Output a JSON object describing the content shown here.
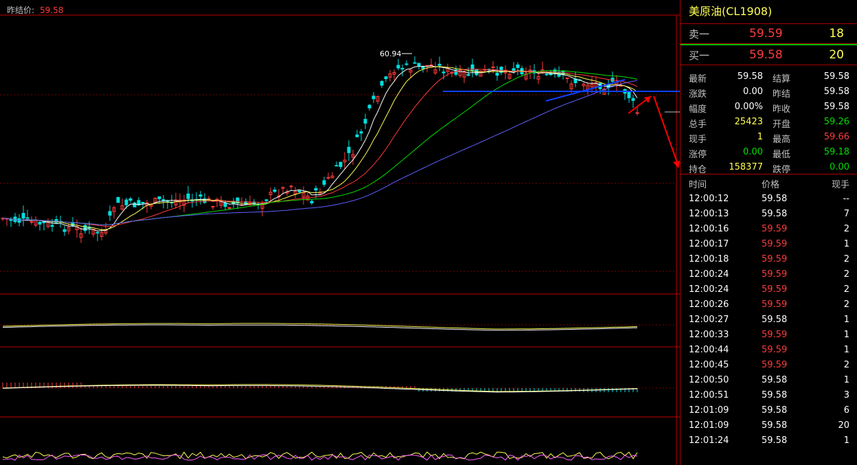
{
  "chart": {
    "prev_settle_label": "昨结价:",
    "prev_settle_value": "59.58",
    "high_marker": "60.94",
    "colors": {
      "up": "#ff3b3b",
      "down": "#00e0e0",
      "ma5": "#ffffff",
      "ma10": "#ffff54",
      "ma20": "#ff3b3b",
      "ma40": "#00e000",
      "ma60": "#6060ff",
      "trendline": "#1040ff",
      "arrow": "#ff0000"
    }
  },
  "panel": {
    "title": "美原油(CL1908)",
    "ask": {
      "label": "卖一",
      "price": "59.59",
      "vol": "18"
    },
    "bid": {
      "label": "买一",
      "price": "59.58",
      "vol": "20"
    },
    "stats": [
      {
        "l1": "最新",
        "v1": "59.58",
        "c1": "w",
        "l2": "结算",
        "v2": "59.58",
        "c2": "w"
      },
      {
        "l1": "涨跌",
        "v1": "0.00",
        "c1": "w",
        "l2": "昨结",
        "v2": "59.58",
        "c2": "w"
      },
      {
        "l1": "幅度",
        "v1": "0.00%",
        "c1": "w",
        "l2": "昨收",
        "v2": "59.58",
        "c2": "w"
      },
      {
        "l1": "总手",
        "v1": "25423",
        "c1": "y",
        "l2": "开盘",
        "v2": "59.26",
        "c2": "g"
      },
      {
        "l1": "现手",
        "v1": "1",
        "c1": "y",
        "l2": "最高",
        "v2": "59.66",
        "c2": "r"
      },
      {
        "l1": "涨停",
        "v1": "0.00",
        "c1": "g",
        "l2": "最低",
        "v2": "59.18",
        "c2": "g"
      },
      {
        "l1": "持仓",
        "v1": "158377",
        "c1": "y",
        "l2": "跌停",
        "v2": "0.00",
        "c2": "g"
      }
    ],
    "ticks_header": {
      "time": "时间",
      "price": "价格",
      "vol": "现手"
    },
    "ticks": [
      {
        "time": "12:00:12",
        "price": "59.58",
        "color": "w",
        "vol": "--"
      },
      {
        "time": "12:00:13",
        "price": "59.58",
        "color": "w",
        "vol": "7"
      },
      {
        "time": "12:00:16",
        "price": "59.59",
        "color": "r",
        "vol": "2"
      },
      {
        "time": "12:00:17",
        "price": "59.59",
        "color": "r",
        "vol": "1"
      },
      {
        "time": "12:00:18",
        "price": "59.59",
        "color": "r",
        "vol": "2"
      },
      {
        "time": "12:00:24",
        "price": "59.59",
        "color": "r",
        "vol": "2"
      },
      {
        "time": "12:00:24",
        "price": "59.59",
        "color": "r",
        "vol": "2"
      },
      {
        "time": "12:00:26",
        "price": "59.59",
        "color": "r",
        "vol": "2"
      },
      {
        "time": "12:00:27",
        "price": "59.58",
        "color": "w",
        "vol": "1"
      },
      {
        "time": "12:00:33",
        "price": "59.59",
        "color": "r",
        "vol": "1"
      },
      {
        "time": "12:00:44",
        "price": "59.59",
        "color": "r",
        "vol": "1"
      },
      {
        "time": "12:00:45",
        "price": "59.59",
        "color": "r",
        "vol": "2"
      },
      {
        "time": "12:00:50",
        "price": "59.58",
        "color": "w",
        "vol": "1"
      },
      {
        "time": "12:00:51",
        "price": "59.58",
        "color": "w",
        "vol": "3"
      },
      {
        "time": "12:01:09",
        "price": "59.58",
        "color": "w",
        "vol": "6"
      },
      {
        "time": "12:01:09",
        "price": "59.58",
        "color": "w",
        "vol": "20"
      },
      {
        "time": "12:01:24",
        "price": "59.58",
        "color": "w",
        "vol": "1"
      }
    ]
  }
}
